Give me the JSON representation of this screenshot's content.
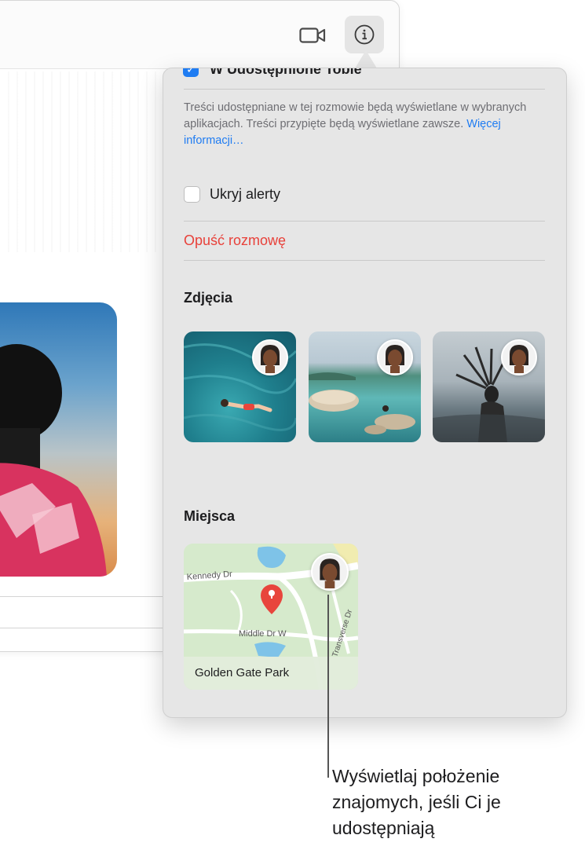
{
  "popover": {
    "cut_option_label": "W Udostępnione Tobie",
    "description": "Treści udostępniane w tej rozmowie będą wyświetlane w wybranych aplikacjach. Treści przypięte będą wyświetlane zawsze.",
    "more_info_link": "Więcej informacji…",
    "hide_alerts_label": "Ukryj alerty",
    "leave_conversation_label": "Opuść rozmowę",
    "photos_section_title": "Zdjęcia",
    "places_section_title": "Miejsca",
    "map": {
      "place_name": "Golden Gate Park",
      "streets": [
        "Kennedy Dr",
        "Middle Dr W",
        "Transverse Dr"
      ]
    }
  },
  "callout": {
    "text": "Wyświetlaj położenie znajomych, jeśli Ci je udostępniają"
  },
  "colors": {
    "accent_blue": "#1f7cf2",
    "destructive_red": "#e8413a"
  },
  "icons": {
    "toolbar": [
      "video-camera-icon",
      "info-icon"
    ]
  }
}
